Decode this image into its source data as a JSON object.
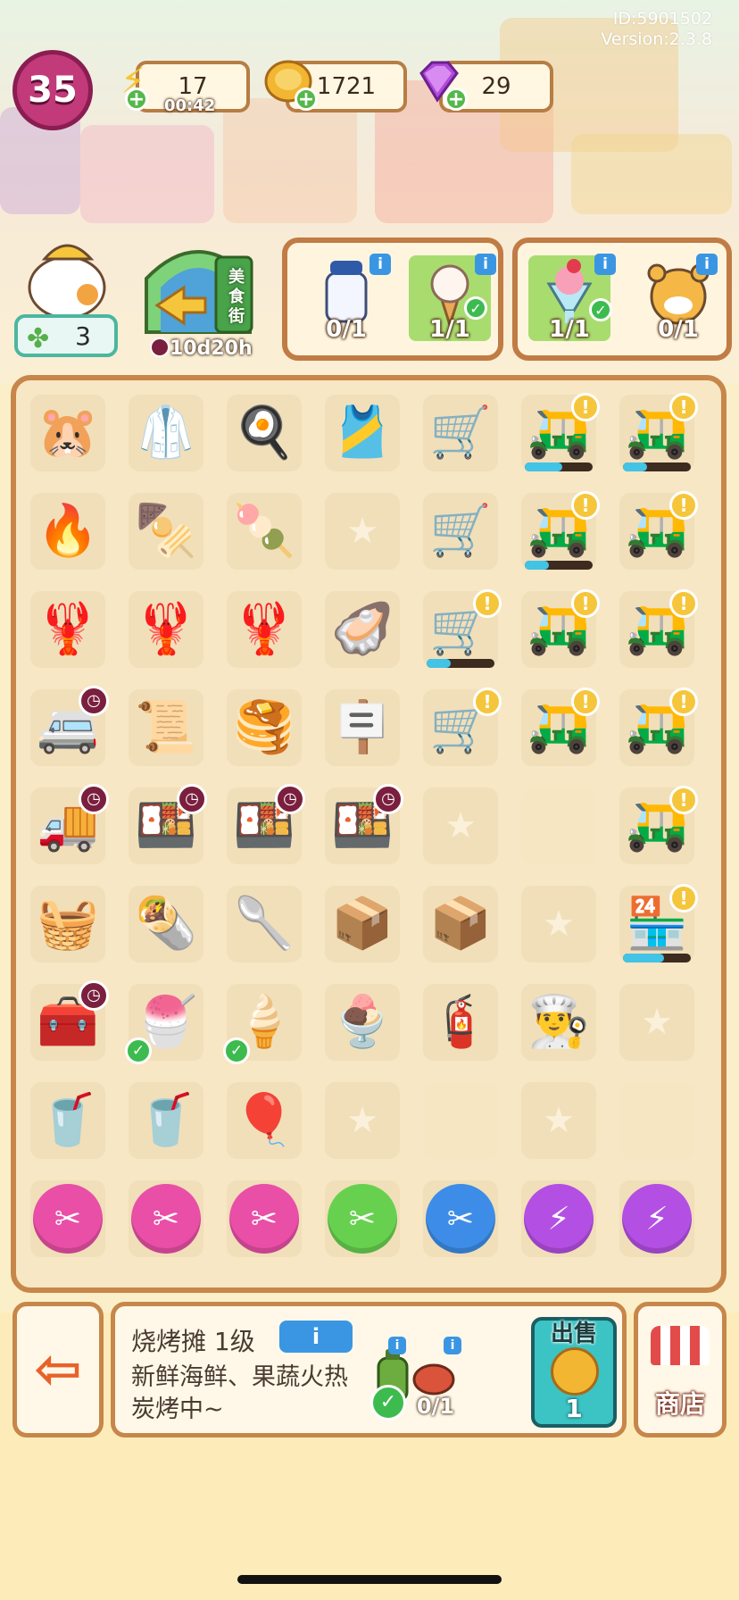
{
  "header": {
    "id_text": "ID:5901502",
    "version_text": "Version:2.3.8",
    "level": "35",
    "energy": {
      "value": "17",
      "timer": "00:42",
      "icon": "lightning-icon"
    },
    "coins": {
      "value": "1721",
      "icon": "coin-icon"
    },
    "gems": {
      "value": "29",
      "icon": "gem-icon"
    }
  },
  "side": {
    "clover_count": "3",
    "event_label": "美食街",
    "event_timer": "10d20h"
  },
  "orders": [
    {
      "items": [
        {
          "icon": "milk-bottle",
          "count": "0/1",
          "done": false
        },
        {
          "icon": "ice-cream-cone",
          "count": "1/1",
          "done": true
        }
      ]
    },
    {
      "items": [
        {
          "icon": "strawberry-sundae",
          "count": "1/1",
          "done": true
        },
        {
          "icon": "tiger-customer",
          "count": "0/1",
          "done": false
        }
      ]
    }
  ],
  "board": [
    [
      "hamster-chef",
      "apron",
      "fried-egg",
      "green-apron",
      "ice-cream-cart",
      "bbq-stall",
      "bbq-stall"
    ],
    [
      "charcoal-grill",
      "skewers",
      "roast-skewers",
      "empty",
      "ice-cream-cart",
      "bbq-stall",
      "bbq-stall"
    ],
    [
      "lobster",
      "lobster",
      "lobster",
      "oysters",
      "ice-cream-cart-pink",
      "bbq-stall",
      "bbq-stall"
    ],
    [
      "food-truck",
      "menu-card",
      "pancakes",
      "open-sign",
      "ice-cream-cart-pink",
      "bbq-stall",
      "bbq-stall"
    ],
    [
      "delivery-truck",
      "lunch-box",
      "lunch-box",
      "lunch-box",
      "empty",
      "blank",
      "bbq-stall"
    ],
    [
      "bread-basket",
      "burrito",
      "scoop",
      "small-box",
      "box-stack",
      "empty",
      "grill-stall"
    ],
    [
      "toaster",
      "strawberry-sundae",
      "ice-cream-cone",
      "matcha-froyo",
      "gas-tank",
      "chef-hat",
      "empty"
    ],
    [
      "rainbow-drink",
      "rainbow-drink",
      "balloons",
      "empty",
      "blank",
      "empty",
      "blank"
    ],
    [
      "scissors-pink",
      "scissors-pink",
      "scissors-pink",
      "scissors-green",
      "scissors-blue",
      "energy-purple",
      "energy-purple"
    ]
  ],
  "detail": {
    "title": "烧烤摊 1级",
    "info_label": "i",
    "description": "新鲜海鲜、果蔬火热炭烤中~",
    "req1_icon": "gas-tank",
    "req2_icon": "lobster",
    "req2_count": "0/1",
    "sell_label": "出售",
    "sell_value": "1"
  },
  "shop_label": "商店",
  "colors": {
    "board_border": "#c7864a",
    "progress_fill": "#43c3e6",
    "level_badge": "#c23a7a",
    "sell_button": "#3cc3c4"
  }
}
